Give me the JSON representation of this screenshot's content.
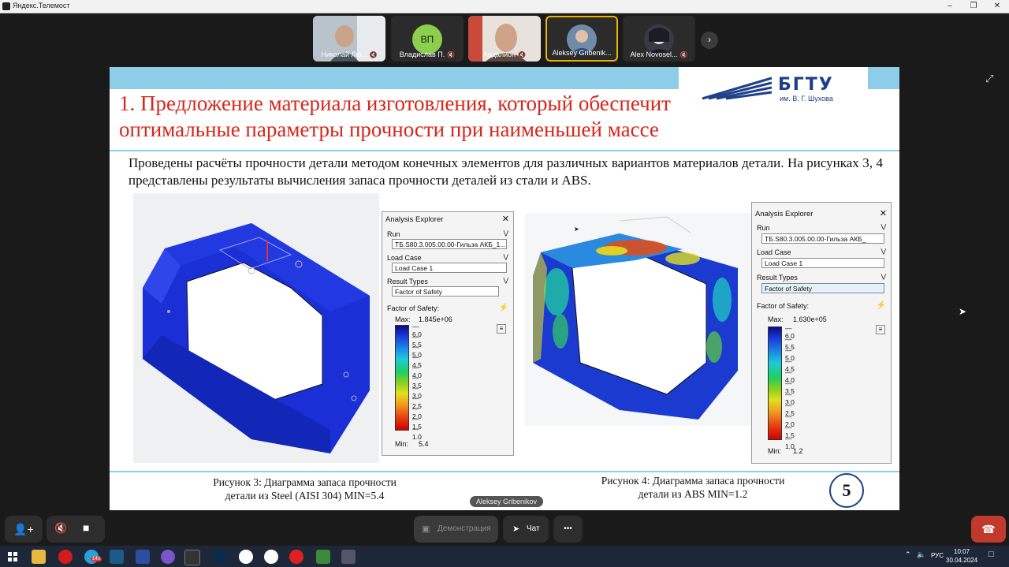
{
  "window": {
    "title": "Яндекс.Телемост"
  },
  "participants": [
    {
      "name": "Николай Лю...",
      "muted": true
    },
    {
      "name": "Владислав П.",
      "initials": "ВП",
      "muted": true
    },
    {
      "name": "Ардалион",
      "muted": true
    },
    {
      "name": "Aleksey Gribenik...",
      "muted": false,
      "active": true
    },
    {
      "name": "Alex Novosel...",
      "muted": true
    }
  ],
  "slide": {
    "logo_main": "БГТУ",
    "logo_sub": "им. В. Г. Шухова",
    "title_line1": "1. Предложение материала изготовления, который обеспечит",
    "title_line2": "оптимальные параметры прочности при наименьшей массе",
    "intro": "Проведены расчёты прочности детали методом конечных элементов для различных вариантов материалов детали. На рисунках 3, 4 представлены результаты вычисления запаса прочности деталей из стали и ABS.",
    "page_number": "5",
    "left": {
      "caption_line1": "Рисунок 3: Диаграмма запаса прочности",
      "caption_line2": "детали из Steel (AISI 304) MIN=5.4",
      "panel": {
        "header": "Analysis Explorer",
        "run_label": "Run",
        "run_value": "ТБ.S80.3.005.00.00-Гильза АКБ_1...",
        "load_case_label": "Load Case",
        "load_case_value": "Load Case 1",
        "result_types_label": "Result Types",
        "result_types_value": "Factor of Safety",
        "fos_label": "Factor of Safety:",
        "max_label": "Max:",
        "max_value": "1.845e+06",
        "min_label": "Min:",
        "min_value": "5.4",
        "ticks": [
          "6.0",
          "5.5",
          "5.0",
          "4.5",
          "4.0",
          "3.5",
          "3.0",
          "2.5",
          "2.0",
          "1.5",
          "1.0"
        ]
      }
    },
    "right": {
      "caption_line1": "Рисунок 4: Диаграмма запаса прочности",
      "caption_line2": "детали из ABS MIN=1.2",
      "panel": {
        "header": "Analysis Explorer",
        "run_label": "Run",
        "run_value": "ТБ.S80.3.005.00.00-Гильза АКБ_",
        "load_case_label": "Load Case",
        "load_case_value": "Load Case 1",
        "result_types_label": "Result Types",
        "result_types_value": "Factor of Safety",
        "fos_label": "Factor of Safety:",
        "max_label": "Max:",
        "max_value": "1.630e+05",
        "min_label": "Min:",
        "min_value": "1.2",
        "ticks": [
          "6.0",
          "5.5",
          "5.0",
          "4.5",
          "4.0",
          "3.5",
          "3.0",
          "2.5",
          "2.0",
          "1.5",
          "1.0"
        ]
      }
    }
  },
  "speaker_tag": "Aleksey Gribenikov",
  "controls": {
    "demo": "Демонстрация",
    "chat": "Чат",
    "more": "•••"
  },
  "taskbar": {
    "lang": "РУС",
    "time": "10:07",
    "date": "30.04.2024",
    "badge": "143"
  },
  "colors": {
    "slide_accent": "#8ecde8",
    "title_red": "#d7261b",
    "logo_blue": "#1e3f8a",
    "hangup": "#c0392b",
    "active_border": "#f0b400"
  }
}
